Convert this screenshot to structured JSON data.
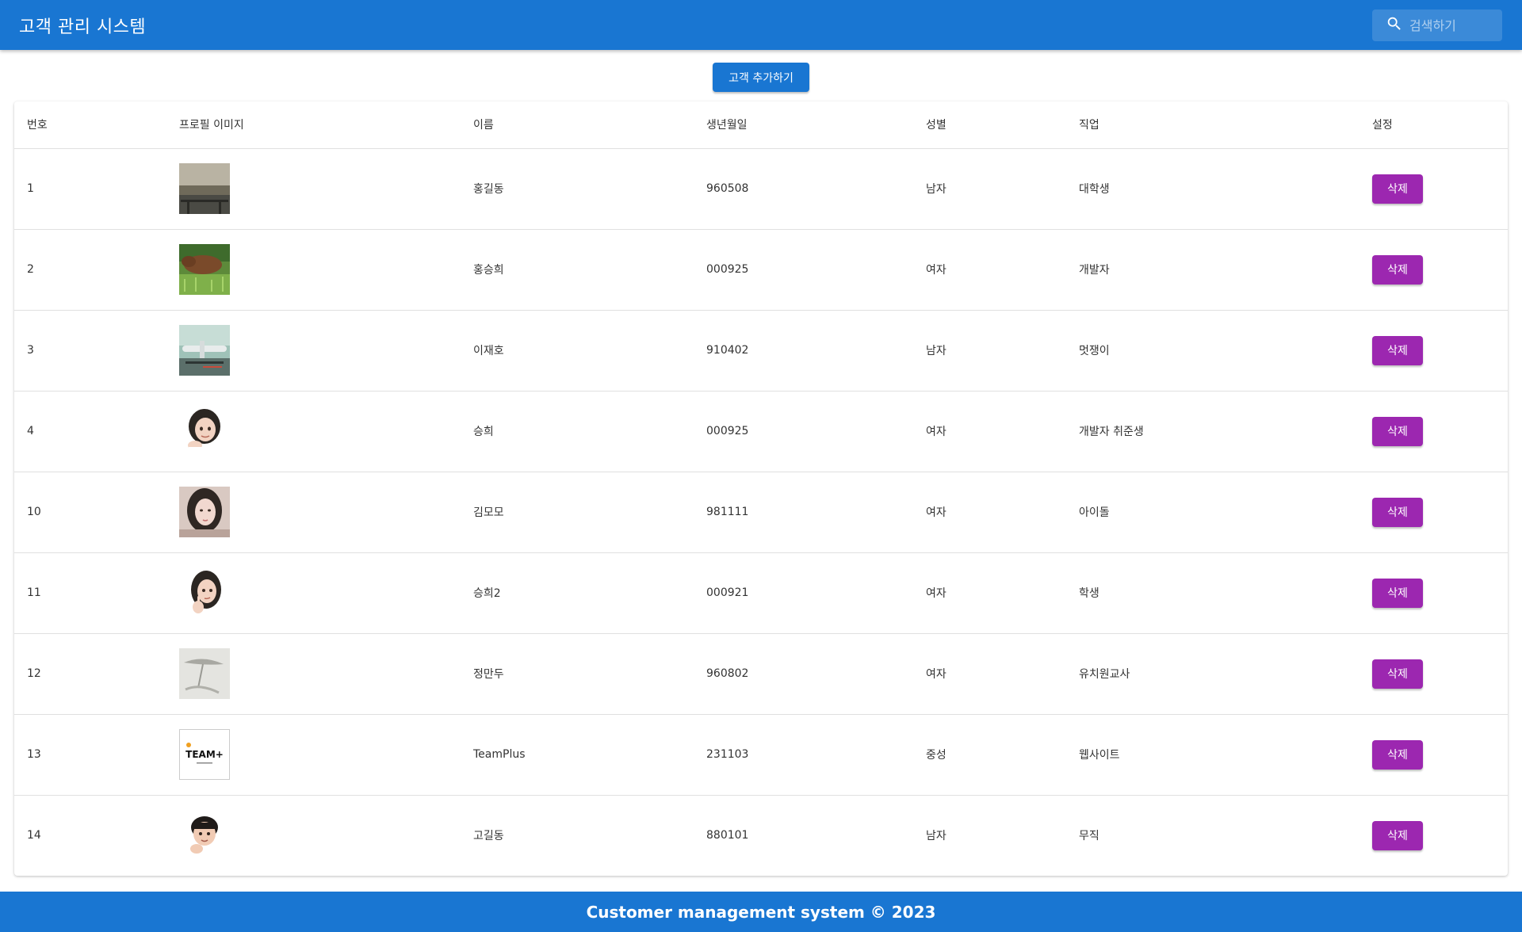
{
  "app": {
    "title": "고객 관리 시스템"
  },
  "search": {
    "placeholder": "검색하기",
    "value": ""
  },
  "actions": {
    "add_label": "고객 추가하기"
  },
  "table": {
    "headers": [
      "번호",
      "프로필 이미지",
      "이름",
      "생년월일",
      "성별",
      "직업",
      "설정"
    ],
    "delete_label": "삭제",
    "rows": [
      {
        "id": "1",
        "image": "landscape-photo",
        "name": "홍길동",
        "birthday": "960508",
        "gender": "남자",
        "job": "대학생"
      },
      {
        "id": "2",
        "image": "horse-photo",
        "name": "홍승희",
        "birthday": "000925",
        "gender": "여자",
        "job": "개발자"
      },
      {
        "id": "3",
        "image": "airplane-photo",
        "name": "이재호",
        "birthday": "910402",
        "gender": "남자",
        "job": "멋쟁이"
      },
      {
        "id": "4",
        "image": "female-avatar",
        "name": "승희",
        "birthday": "000925",
        "gender": "여자",
        "job": "개발자 취준생"
      },
      {
        "id": "10",
        "image": "portrait-photo",
        "name": "김모모",
        "birthday": "981111",
        "gender": "여자",
        "job": "아이돌"
      },
      {
        "id": "11",
        "image": "female-avatar-thinking",
        "name": "승희2",
        "birthday": "000921",
        "gender": "여자",
        "job": "학생"
      },
      {
        "id": "12",
        "image": "shadow-photo",
        "name": "정만두",
        "birthday": "960802",
        "gender": "여자",
        "job": "유치원교사"
      },
      {
        "id": "13",
        "image": "team-plus-logo",
        "name": "TeamPlus",
        "birthday": "231103",
        "gender": "중성",
        "job": "웹사이트"
      },
      {
        "id": "14",
        "image": "male-avatar",
        "name": "고길동",
        "birthday": "880101",
        "gender": "남자",
        "job": "무직"
      }
    ]
  },
  "thumb_logo_text": "TEAM+",
  "footer": {
    "text": "Customer management system © 2023"
  },
  "colors": {
    "primary": "#1976d2",
    "secondary": "#9c27b0"
  }
}
